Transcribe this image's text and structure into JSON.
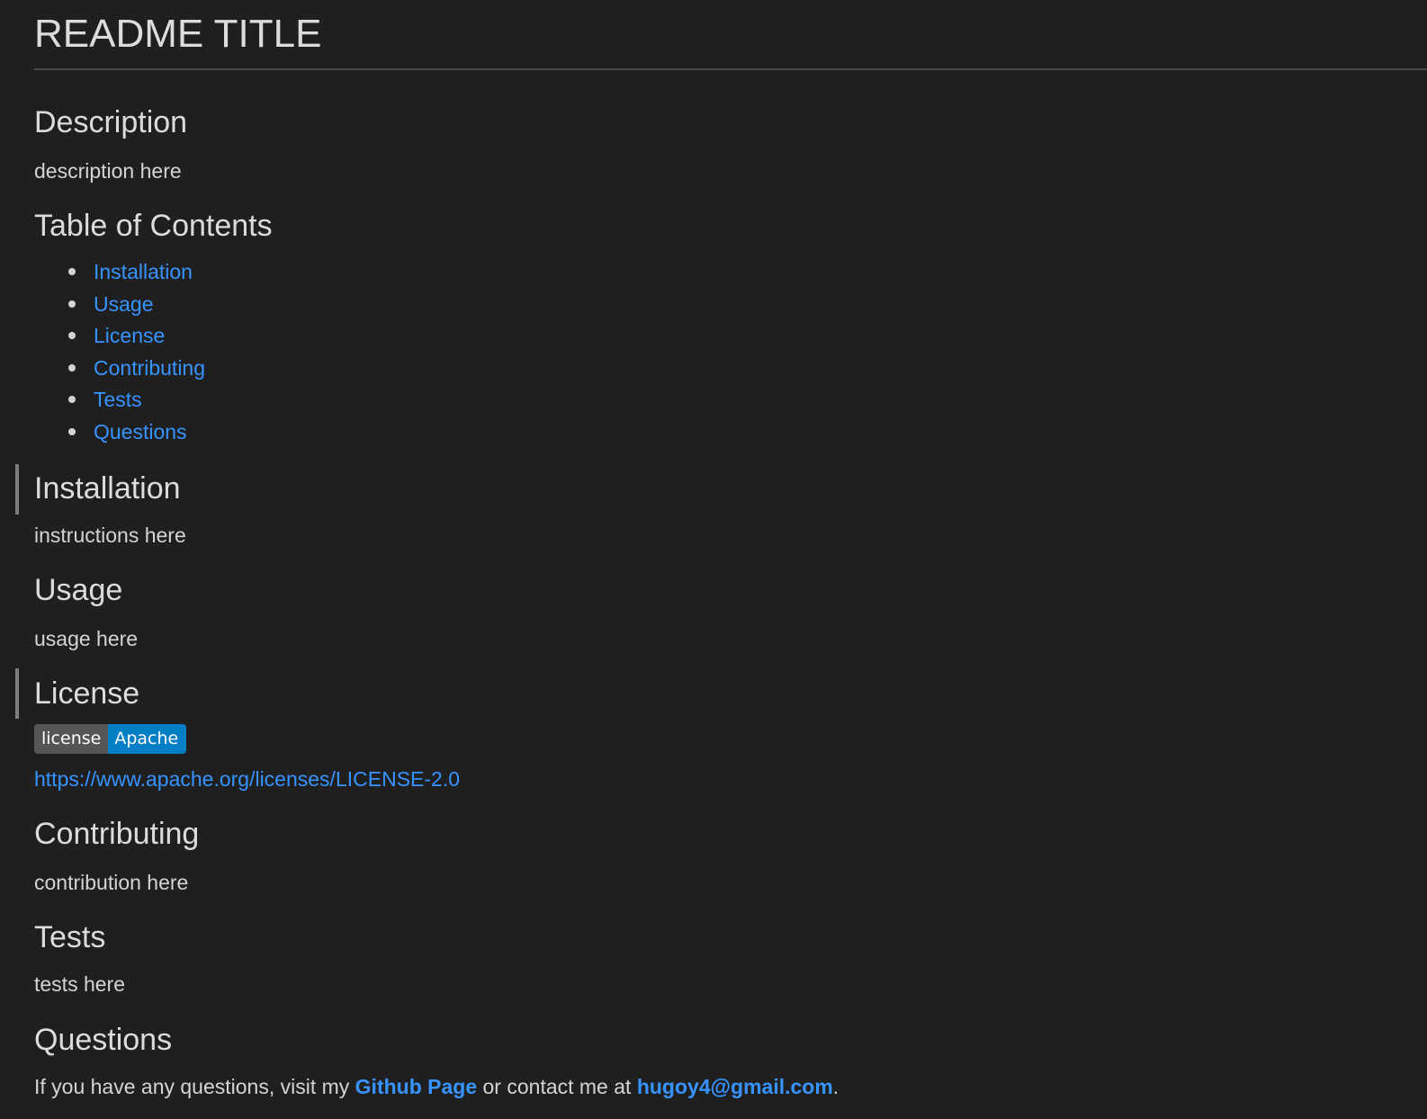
{
  "title": "README TITLE",
  "sections": {
    "description": {
      "heading": "Description",
      "text": "description here"
    },
    "toc": {
      "heading": "Table of Contents",
      "items": [
        "Installation",
        "Usage",
        "License",
        "Contributing",
        "Tests",
        "Questions"
      ]
    },
    "installation": {
      "heading": "Installation",
      "text": "instructions here"
    },
    "usage": {
      "heading": "Usage",
      "text": "usage here"
    },
    "license": {
      "heading": "License",
      "badge_label": "license",
      "badge_value": "Apache",
      "link": "https://www.apache.org/licenses/LICENSE-2.0"
    },
    "contributing": {
      "heading": "Contributing",
      "text": "contribution here"
    },
    "tests": {
      "heading": "Tests",
      "text": "tests here"
    },
    "questions": {
      "heading": "Questions",
      "text_before": "If you have any questions, visit my ",
      "github_link": "Github Page",
      "text_middle": " or contact me at ",
      "email_link": "hugoy4@gmail.com",
      "text_after": "."
    }
  },
  "colors": {
    "background": "#1f1f1f",
    "text": "#d4d4d4",
    "link": "#3794ff",
    "badge_label_bg": "#555555",
    "badge_value_bg": "#007ec6"
  }
}
